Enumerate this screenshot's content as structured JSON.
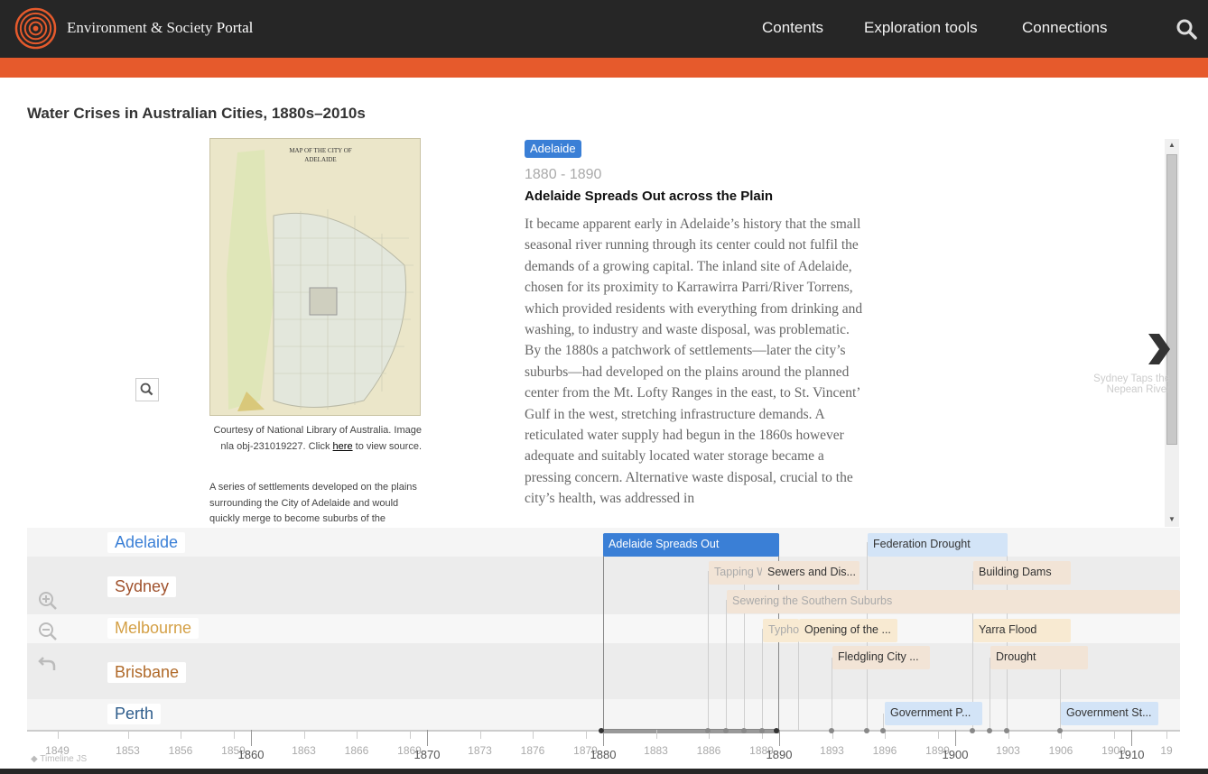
{
  "header": {
    "brand_main": "Environment & Society",
    "brand_portal": "Portal",
    "nav": [
      "Contents",
      "Exploration tools",
      "Connections"
    ],
    "search_icon": "search-icon",
    "colors": {
      "bar": "#262626",
      "accent": "#e65a2c"
    }
  },
  "page": {
    "title": "Water Crises in Australian Cities, 1880s–2010s"
  },
  "slide": {
    "map_heading": "MAP OF THE CITY OF ADELAIDE",
    "credit_before": "Courtesy of National Library of Australia. Image nla obj-231019227. Click ",
    "credit_link": "here",
    "credit_after": " to view source.",
    "caption": "A series of settlements developed on the plains surrounding the City of Adelaide and would quickly merge to become suburbs of the",
    "tag": "Adelaide",
    "date": "1880 - 1890",
    "headline": "Adelaide Spreads Out across the Plain",
    "body": "It became apparent early in Adelaide’s history that the small seasonal river running through its center could not fulfil the demands of a growing capital. The inland site of Adelaide, chosen for its proximity to Karrawirra Parri/River Torrens, which provided residents with everything from drinking and washing, to industry and waste disposal, was problematic. By the 1880s a patchwork of settlements—later the city’s suburbs—had developed on the plains around the planned center from the Mt. Lofty Ranges in the east, to St. Vincent’ Gulf in the west, stretching infrastructure demands. A reticulated water supply had begun in the 1860s however adequate and suitably located water storage became a pressing concern. Alternative waste disposal, crucial to the city’s health, was addressed in",
    "next_title": "Sydney Taps the Nepean River"
  },
  "timeline": {
    "groups": [
      {
        "label": "Adelaide",
        "color": "#3a7fd6"
      },
      {
        "label": "Sydney",
        "color": "#a0522d"
      },
      {
        "label": "Melbourne",
        "color": "#d4a046"
      },
      {
        "label": "Brisbane",
        "color": "#b06a2a"
      },
      {
        "label": "Perth",
        "color": "#2e5d8c"
      }
    ],
    "events": {
      "adelaide_spreads": "Adelaide Spreads Out",
      "federation_drought": "Federation Drought",
      "tapping": "Tapping W",
      "sewers": "Sewers and Dis...",
      "building_dams": "Building Dams",
      "sewering_southern": "Sewering the Southern Suburbs",
      "typho": "Typho",
      "opening": "Opening of the ...",
      "yarra_flood": "Yarra Flood",
      "fledgling": "Fledgling City ...",
      "drought": "Drought",
      "gov_p": "Government P...",
      "gov_st": "Government St..."
    },
    "minor_years": [
      "1849",
      "1853",
      "1856",
      "1859",
      "1863",
      "1866",
      "1869",
      "1873",
      "1876",
      "1879",
      "1883",
      "1886",
      "1889",
      "1893",
      "1896",
      "1899",
      "1903",
      "1906",
      "1909",
      "19"
    ],
    "major_years": [
      "1860",
      "1870",
      "1880",
      "1890",
      "1900",
      "1910"
    ],
    "credit": "Timeline JS"
  }
}
